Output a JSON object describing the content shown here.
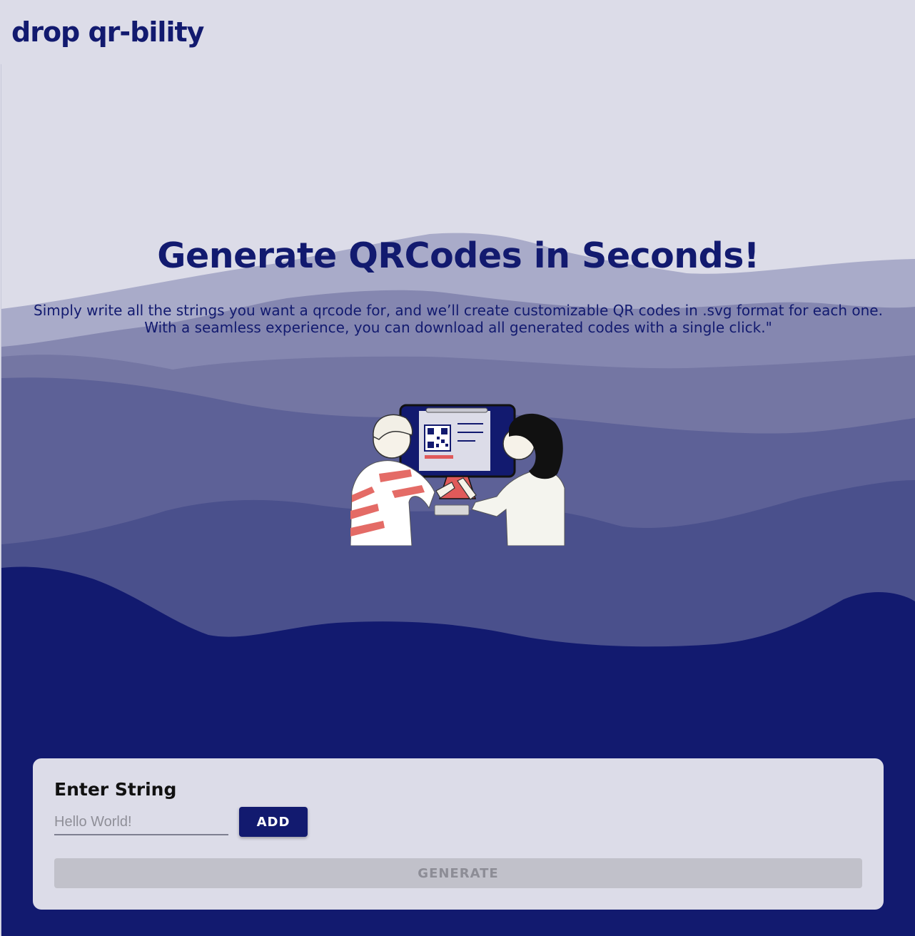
{
  "brand": {
    "name": "drop qr-bility"
  },
  "hero": {
    "title": "Generate QRCodes in Seconds!",
    "description": "Simply write all the strings you want a qrcode for, and we’ll create customizable QR codes in .svg format for each one. With a seamless experience, you can download all generated codes with a single click.\""
  },
  "form": {
    "label": "Enter String",
    "input_placeholder": "Hello World!",
    "input_value": "",
    "add_label": "ADD",
    "generate_label": "GENERATE",
    "generate_disabled": true
  },
  "colors": {
    "primary": "#121a6f",
    "background": "#dcdce8",
    "wave_light": "#a9abc9",
    "wave_mid": "#8587b0",
    "wave_mid2": "#7476a3",
    "wave_dark": "#5d6197",
    "wave_darker": "#4a508c",
    "disabled_bg": "#c1c1ca",
    "disabled_text": "#8d8d96"
  },
  "icons": {
    "illustration": "people-with-qr-monitor-illustration"
  }
}
